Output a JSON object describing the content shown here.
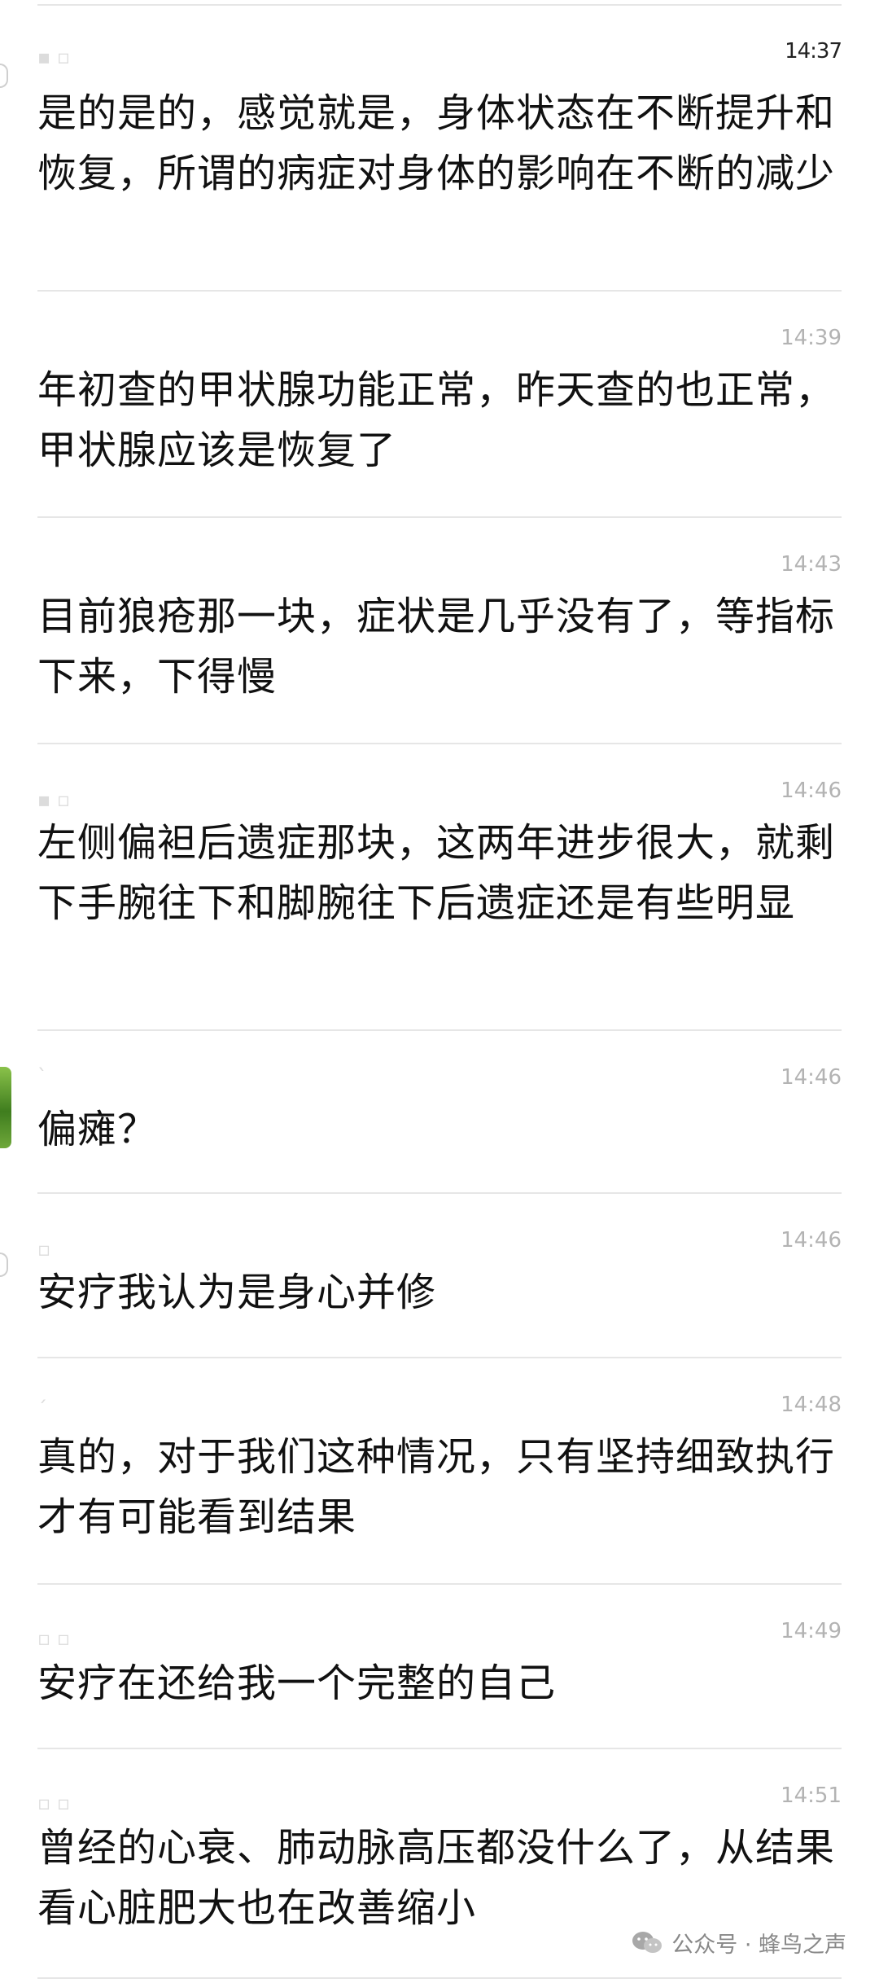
{
  "status_time": "14:37",
  "messages": [
    {
      "time": "",
      "text": "是的是的，感觉就是，身体状态在不断提升和恢复，所谓的病症对身体的影响在不断的减少"
    },
    {
      "time": "14:39",
      "text": "年初查的甲状腺功能正常，昨天查的也正常，甲状腺应该是恢复了"
    },
    {
      "time": "14:43",
      "text": "目前狼疮那一块，症状是几乎没有了，等指标下来，下得慢"
    },
    {
      "time": "14:46",
      "text": "左侧偏袒后遗症那块，这两年进步很大，就剩下手腕往下和脚腕往下后遗症还是有些明显"
    },
    {
      "time": "14:46",
      "text": "偏瘫？"
    },
    {
      "time": "14:46",
      "text": "安疗我认为是身心并修"
    },
    {
      "time": "14:48",
      "text": "真的，对于我们这种情况，只有坚持细致执行才有可能看到结果"
    },
    {
      "time": "14:49",
      "text": "安疗在还给我一个完整的自己"
    },
    {
      "time": "14:51",
      "text": "曾经的心衰、肺动脉高压都没什么了，从结果看心脏肥大也在改善缩小"
    }
  ],
  "watermark": {
    "icon": "wechat-icon",
    "text": "公众号 · 蜂鸟之声"
  },
  "colors": {
    "background": "#ffffff",
    "text": "#111111",
    "time": "#b3b3b3",
    "divider": "#e6e6e6"
  }
}
